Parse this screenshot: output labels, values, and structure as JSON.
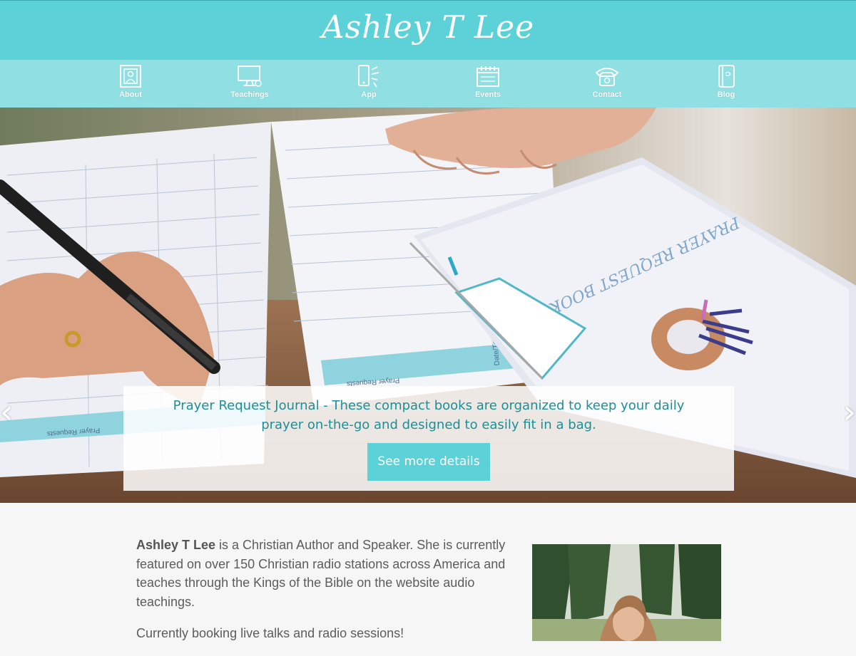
{
  "header": {
    "logo_text": "Ashley T Lee"
  },
  "nav": {
    "items": [
      {
        "label": "About",
        "icon": "framed-portrait-icon"
      },
      {
        "label": "Teachings",
        "icon": "monitor-icon"
      },
      {
        "label": "App",
        "icon": "phone-icon"
      },
      {
        "label": "Events",
        "icon": "calendar-icon"
      },
      {
        "label": "Contact",
        "icon": "telephone-icon"
      },
      {
        "label": "Blog",
        "icon": "blog-book-icon"
      }
    ]
  },
  "hero": {
    "prev_arrow": "‹",
    "next_arrow": "›",
    "caption": "Prayer Request Journal - These compact books are organized to keep your daily prayer on-the-go and designed to easily fit in a bag.",
    "button_label": "See more details",
    "book_title": "PRAYER REQUEST BOOK",
    "page_label_1": "Prayer Requests",
    "page_label_2": "Prayer Requests",
    "page_label_3": "Date/Title"
  },
  "bio": {
    "name": "Ashley T Lee",
    "paragraph_1_rest": " is a Christian Author and Speaker. She is currently featured on over 150 Christian radio stations across America and teaches through the Kings of the Bible on the website audio teachings.",
    "paragraph_2": "Currently booking live talks and radio sessions!"
  },
  "colors": {
    "header": "#5dd1d8",
    "nav": "#8fdfe3",
    "accent_text": "#1c8f96",
    "button": "#5dd1d8"
  }
}
